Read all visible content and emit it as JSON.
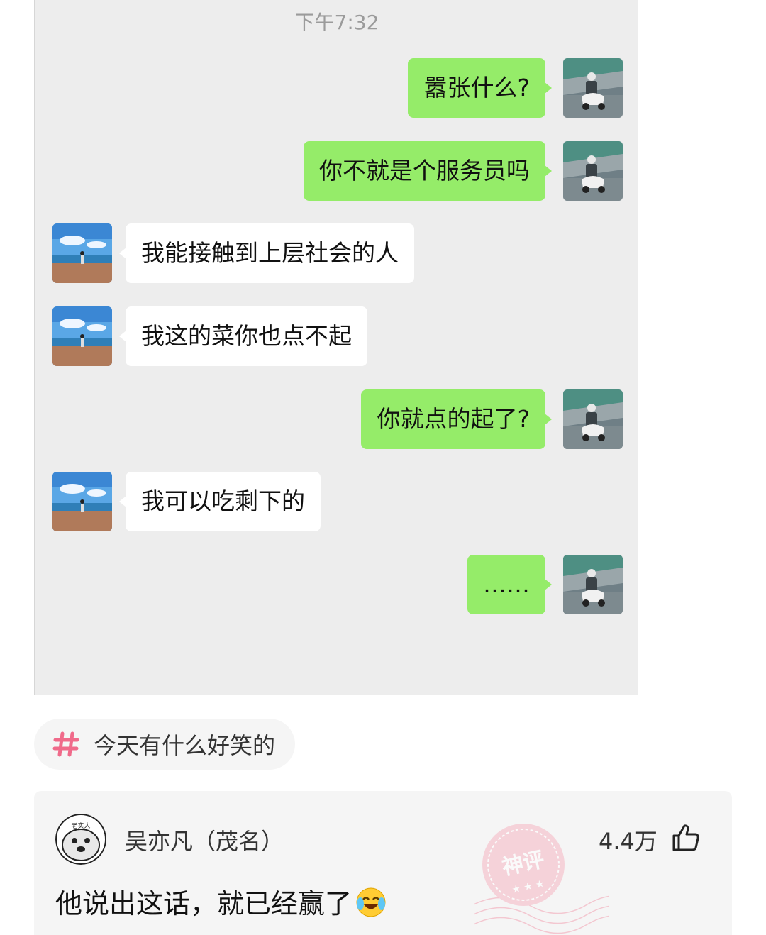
{
  "chat": {
    "timestamp": "下午7:32",
    "messages": [
      {
        "side": "right",
        "text": "嚣张什么?"
      },
      {
        "side": "right",
        "text": "你不就是个服务员吗"
      },
      {
        "side": "left",
        "text": "我能接触到上层社会的人"
      },
      {
        "side": "left",
        "text": "我这的菜你也点不起"
      },
      {
        "side": "right",
        "text": "你就点的起了?"
      },
      {
        "side": "left",
        "text": "我可以吃剩下的"
      },
      {
        "side": "right",
        "text": "……"
      }
    ]
  },
  "topic": {
    "icon": "hashtag-icon",
    "label": "今天有什么好笑的"
  },
  "comment": {
    "author": "吴亦凡（茂名）",
    "likes": "4.4万",
    "text": "他说出这话，就已经赢了",
    "emoji": "crying-laughing-emoji",
    "stamp_text": "神评",
    "avatar_caption": "老实人",
    "colors": {
      "stamp": "#f2a3b3",
      "hashtag": "#f06a8a",
      "bubble_green": "#95ec69"
    }
  }
}
